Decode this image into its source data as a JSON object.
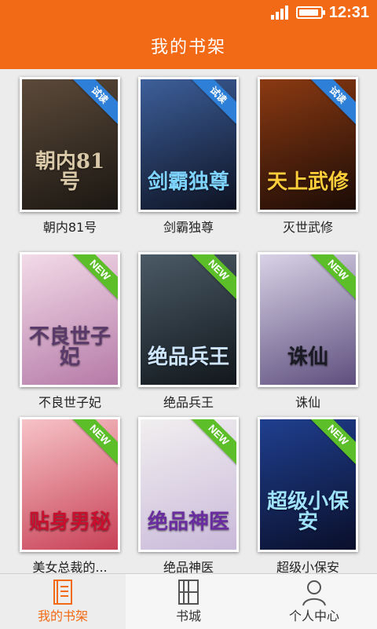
{
  "status": {
    "time": "12:31"
  },
  "header": {
    "title": "我的书架"
  },
  "books": [
    {
      "title": "朝内81号",
      "badge": "试读",
      "cover_text": "朝内81号",
      "cover_colors": [
        "#5c4a3a",
        "#1b1712"
      ],
      "accent": "#d9c9a8"
    },
    {
      "title": "剑霸独尊",
      "badge": "试读",
      "cover_text": "剑霸独尊",
      "cover_colors": [
        "#3d5f9a",
        "#0d1222"
      ],
      "accent": "#7fd4ff"
    },
    {
      "title": "灭世武修",
      "badge": "试读",
      "cover_text": "天上武修",
      "cover_colors": [
        "#8b3a12",
        "#1b0b06"
      ],
      "accent": "#ffce3a"
    },
    {
      "title": "不良世子妃",
      "badge": "NEW",
      "cover_text": "不良世子妃",
      "cover_colors": [
        "#f3dbe8",
        "#b57aa8"
      ],
      "accent": "#5a3a6a"
    },
    {
      "title": "绝品兵王",
      "badge": "NEW",
      "cover_text": "绝品兵王",
      "cover_colors": [
        "#4b5a66",
        "#11171c"
      ],
      "accent": "#cfe6ff"
    },
    {
      "title": "诛仙",
      "badge": "NEW",
      "cover_text": "诛仙",
      "cover_colors": [
        "#d8d2e6",
        "#5e4f7e"
      ],
      "accent": "#1a1a24"
    },
    {
      "title": "美女总裁的...",
      "badge": "NEW",
      "cover_text": "贴身男秘",
      "cover_colors": [
        "#f6c3c7",
        "#c84156"
      ],
      "accent": "#c8102e"
    },
    {
      "title": "绝品神医",
      "badge": "NEW",
      "cover_text": "绝品神医",
      "cover_colors": [
        "#f1efef",
        "#c9b9da"
      ],
      "accent": "#6a2da0"
    },
    {
      "title": "超级小保安",
      "badge": "NEW",
      "cover_text": "超级小保安",
      "cover_colors": [
        "#1f3f8f",
        "#0a0f2a"
      ],
      "accent": "#9fe3ff"
    }
  ],
  "tabs": [
    {
      "label": "我的书架",
      "icon": "bookshelf-icon",
      "active": true
    },
    {
      "label": "书城",
      "icon": "bookstore-icon",
      "active": false
    },
    {
      "label": "个人中心",
      "icon": "user-icon",
      "active": false
    }
  ],
  "colors": {
    "brand": "#f26a16",
    "trial_badge": "#2e7fd8",
    "new_badge": "#5cbf2a"
  }
}
